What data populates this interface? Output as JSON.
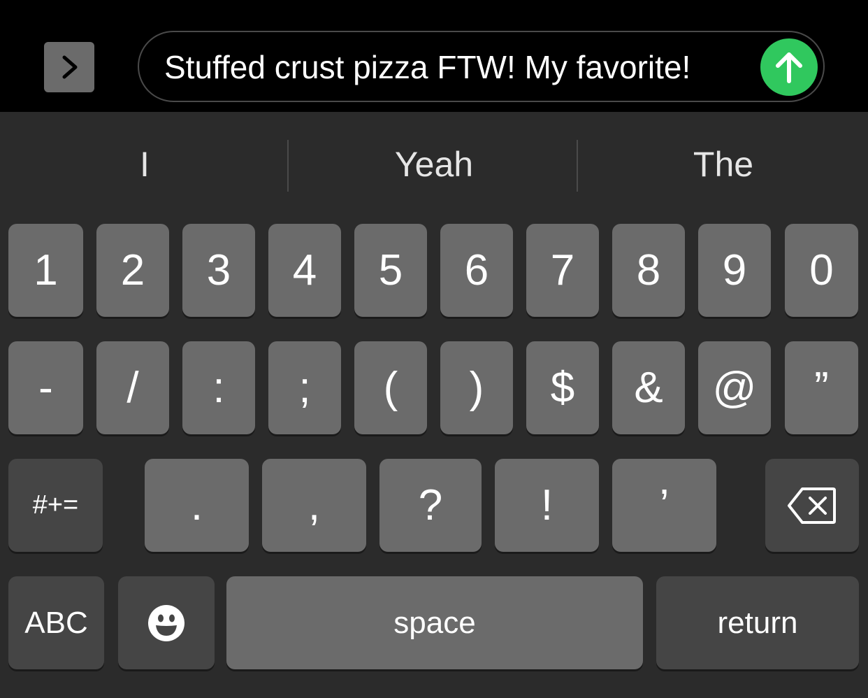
{
  "input": {
    "text": "Stuffed crust pizza FTW! My favorite!"
  },
  "suggestions": [
    "I",
    "Yeah",
    "The"
  ],
  "keys": {
    "row1": [
      "1",
      "2",
      "3",
      "4",
      "5",
      "6",
      "7",
      "8",
      "9",
      "0"
    ],
    "row2": [
      "-",
      "/",
      ":",
      ";",
      "(",
      ")",
      "$",
      "&",
      "@",
      "”"
    ],
    "row3": {
      "symbols": "#+=",
      "punct": [
        ".",
        ",",
        "?",
        "!",
        "’"
      ]
    },
    "row4": {
      "abc": "ABC",
      "space": "space",
      "return": "return"
    }
  },
  "icons": {
    "expand": "chevron-right-icon",
    "send": "arrow-up-icon",
    "delete": "backspace-icon",
    "emoji": "smiley-face-icon"
  },
  "colors": {
    "send_button": "#30c85e",
    "key": "#6b6b6b",
    "key_dark": "#454545",
    "keyboard_bg": "#2b2b2b"
  }
}
